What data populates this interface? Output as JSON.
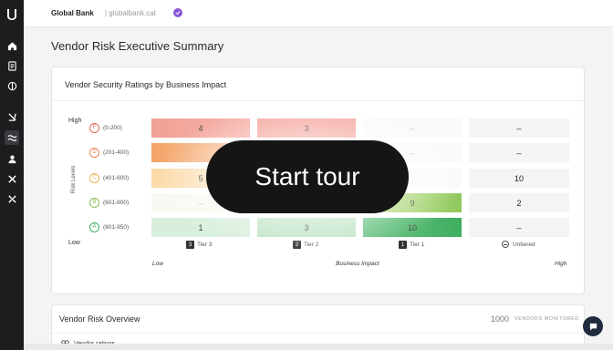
{
  "org": {
    "name": "Global Bank",
    "domain": "| globalbank.cat"
  },
  "page_title": "Vendor Risk Executive Summary",
  "matrix": {
    "title": "Vendor Security Ratings by Business Impact",
    "y_high": "High",
    "y_low": "Low",
    "y_axis_title": "Risk Levels",
    "x_low": "Low",
    "x_title": "Business Impact",
    "x_high": "High",
    "rows": [
      {
        "grade": "F",
        "range": "(0-200)",
        "color": "#e06a5c",
        "cells": [
          "4",
          "3",
          "–",
          "–"
        ]
      },
      {
        "grade": "D",
        "range": "(201-400)",
        "color": "#e8885a",
        "cells": [
          "",
          "",
          "–",
          "–"
        ]
      },
      {
        "grade": "C",
        "range": "(401-600)",
        "color": "#e9b24e",
        "cells": [
          "5",
          "",
          "",
          "10"
        ]
      },
      {
        "grade": "B",
        "range": "(601-800)",
        "color": "#8fbf5a",
        "cells": [
          "–",
          "",
          "9",
          "2"
        ]
      },
      {
        "grade": "A",
        "range": "(801-950)",
        "color": "#3fae5f",
        "cells": [
          "1",
          "3",
          "10",
          "–"
        ]
      }
    ],
    "columns": [
      {
        "box": "3",
        "label": "Tier 3"
      },
      {
        "box": "2",
        "label": "Tier 2"
      },
      {
        "box": "1",
        "label": "Tier 1"
      },
      {
        "box": "",
        "label": "Untiered"
      }
    ]
  },
  "overview": {
    "title": "Vendor Risk Overview",
    "count": "1000",
    "count_label": "VENDORS MONITORED",
    "ratings_label": "Vendor ratings"
  },
  "tour": {
    "label": "Start tour"
  }
}
